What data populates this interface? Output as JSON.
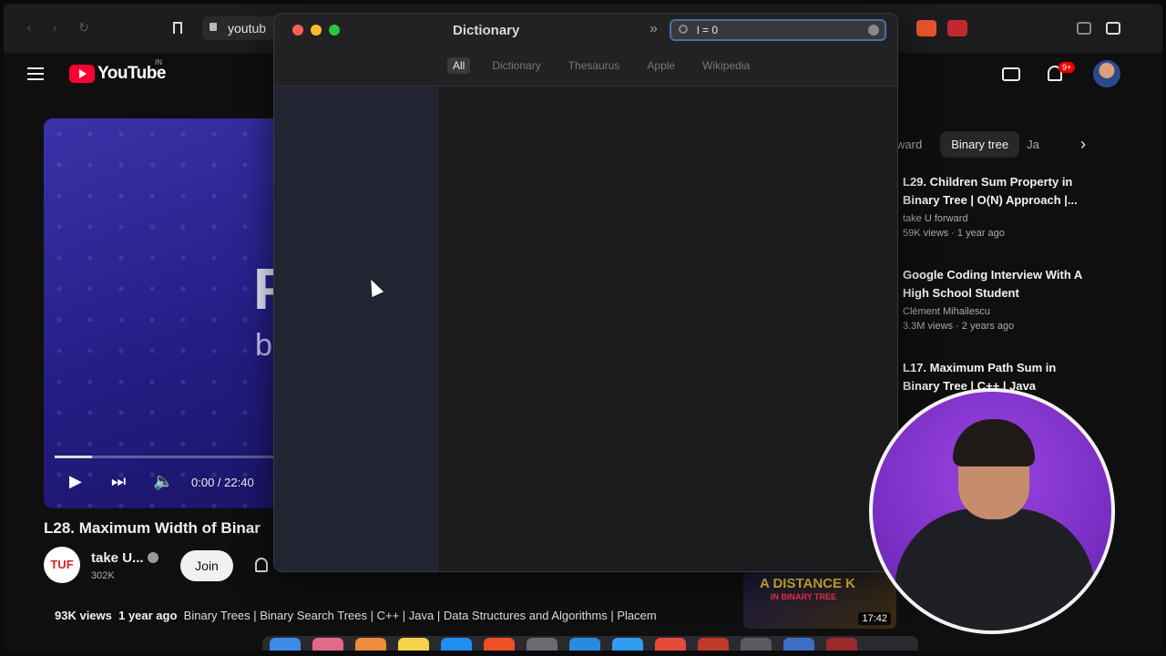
{
  "browser": {
    "url": "youtub",
    "colors": {
      "accent": "#4a6fa5"
    }
  },
  "youtube": {
    "logo_text": "YouTube",
    "country": "IN",
    "notifications": "9+",
    "player": {
      "time": "0:00 / 22:40",
      "progress": 0.15
    },
    "video_title": "L28. Maximum Width of Binar",
    "channel": {
      "logo_text": "TUF",
      "name": "take U...",
      "subscribers": "302K",
      "join_label": "Join"
    },
    "description": {
      "views": "93K views",
      "age": "1 year ago",
      "tags": "Binary Trees | Binary Search Trees | C++ | Java | Data Structures and Algorithms | Placem"
    },
    "chips": [
      "ward",
      "Binary tree",
      "Ja"
    ],
    "recommendations": [
      {
        "title": "L29. Children Sum Property in Binary Tree | O(N) Approach |...",
        "channel": "take U forward",
        "meta": "59K views · 1 year ago"
      },
      {
        "title": "Google Coding Interview With A High School Student",
        "channel": "Clément Mihailescu",
        "meta": "3.3M views · 2 years ago"
      },
      {
        "title": "L17. Maximum Path Sum in Binary Tree | C++ | Java",
        "channel": "",
        "meta": ""
      }
    ],
    "thumb": {
      "line1": "A DISTANCE K",
      "line2": "IN BINARY TREE",
      "duration": "17:42"
    }
  },
  "dictionary": {
    "title": "Dictionary",
    "search_value": "l = 0",
    "tabs": [
      "All",
      "Dictionary",
      "Thesaurus",
      "Apple",
      "Wikipedia"
    ],
    "active_tab": "All"
  }
}
